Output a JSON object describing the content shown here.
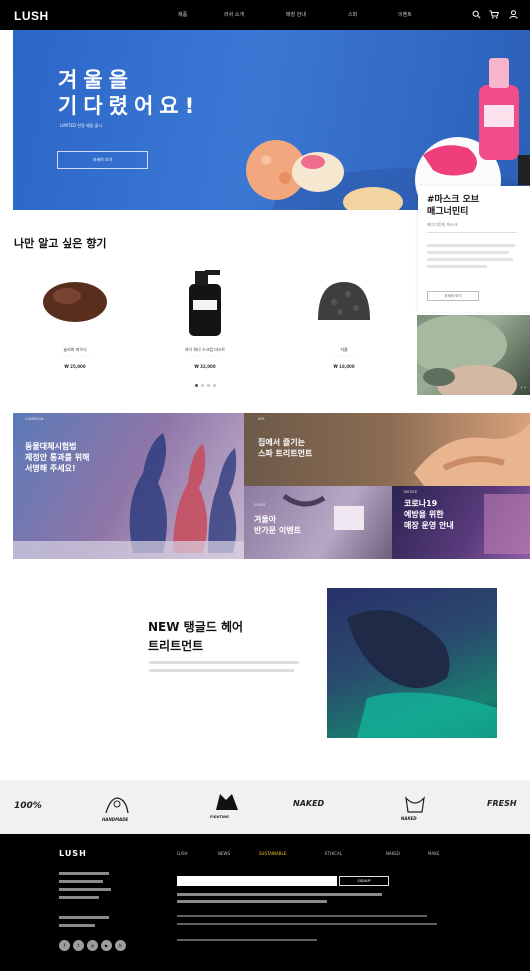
{
  "header": {
    "logo": "LUSH",
    "nav": [
      "제품",
      "러쉬 소개",
      "매장 안내",
      "스파",
      "이벤트"
    ]
  },
  "hero": {
    "title": "겨울을\n기다렸어요!",
    "subtitle": "LIMITED 한정 제품 출시",
    "button": "자세히 보기",
    "bg_color": "#3b78d4"
  },
  "side_card": {
    "title": "#마스크 오브\n매그너민티",
    "subtitle": "매그너민티 마스크",
    "button": "자세히 보기"
  },
  "products_section": {
    "title": "나만 알고 싶은 향기",
    "items": [
      {
        "name": "슬리피 파우더",
        "price": "₩ 25,000"
      },
      {
        "name": "아이 워너 스크럽 미스트",
        "price": "₩ 32,000"
      },
      {
        "name": "차콜",
        "price": "₩ 18,000"
      }
    ]
  },
  "banners": {
    "b1": {
      "tag": "CAMPAIGN",
      "text": "동물대체시험법\n제정안 통과를 위해\n서명해 주세요!"
    },
    "b2": {
      "tag": "SPA",
      "text": "집에서 즐기는\n스파 트리트먼트"
    },
    "b3": {
      "tag": "EVENT",
      "text": "겨울아\n반가운 이벤트"
    },
    "b4": {
      "tag": "NOTICE",
      "text": "코로나19\n예방을 위한\n매장 운영 안내"
    }
  },
  "feature": {
    "title": "NEW 탱글드 헤어\n트리트먼트"
  },
  "badges": [
    "100%",
    "HANDMADE",
    "FIGHTING",
    "NAKED",
    "NAKED",
    "FRESH"
  ],
  "footer": {
    "logo": "LUSH",
    "links": [
      "LUSH",
      "NEWS",
      "SUSTAINABLE",
      "ETHICAL",
      "NAKED",
      "MAKE"
    ],
    "newsletter_button": "SIGNUP"
  },
  "colors": {
    "header": "#000000",
    "footer": "#000000",
    "footer_highlight": "#f2c431"
  }
}
